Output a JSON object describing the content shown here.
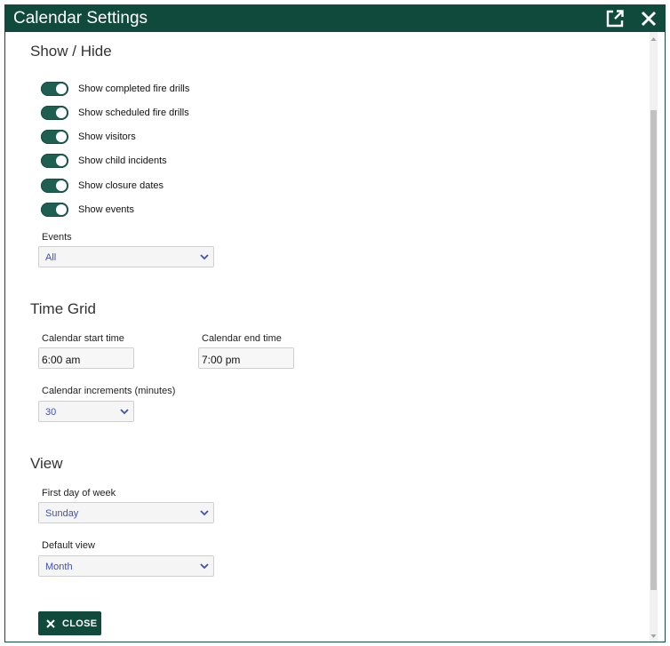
{
  "window": {
    "title": "Calendar Settings",
    "popout_icon": "external-link-icon",
    "close_icon": "close-icon"
  },
  "show_hide": {
    "heading": "Show / Hide",
    "toggles": [
      {
        "label": "Show completed fire drills",
        "on": true
      },
      {
        "label": "Show scheduled fire drills",
        "on": true
      },
      {
        "label": "Show visitors",
        "on": true
      },
      {
        "label": "Show child incidents",
        "on": true
      },
      {
        "label": "Show closure dates",
        "on": true
      },
      {
        "label": "Show events",
        "on": true
      }
    ],
    "events_label": "Events",
    "events_value": "All"
  },
  "time_grid": {
    "heading": "Time Grid",
    "start_label": "Calendar start time",
    "start_value": "6:00 am",
    "end_label": "Calendar end time",
    "end_value": "7:00 pm",
    "increments_label": "Calendar increments (minutes)",
    "increments_value": "30"
  },
  "view": {
    "heading": "View",
    "first_day_label": "First day of week",
    "first_day_value": "Sunday",
    "default_view_label": "Default view",
    "default_view_value": "Month"
  },
  "footer": {
    "close_label": "CLOSE"
  },
  "colors": {
    "brand": "#0f4a3c",
    "toggle_on": "#1f5f52",
    "select_text": "#3f51b5"
  }
}
